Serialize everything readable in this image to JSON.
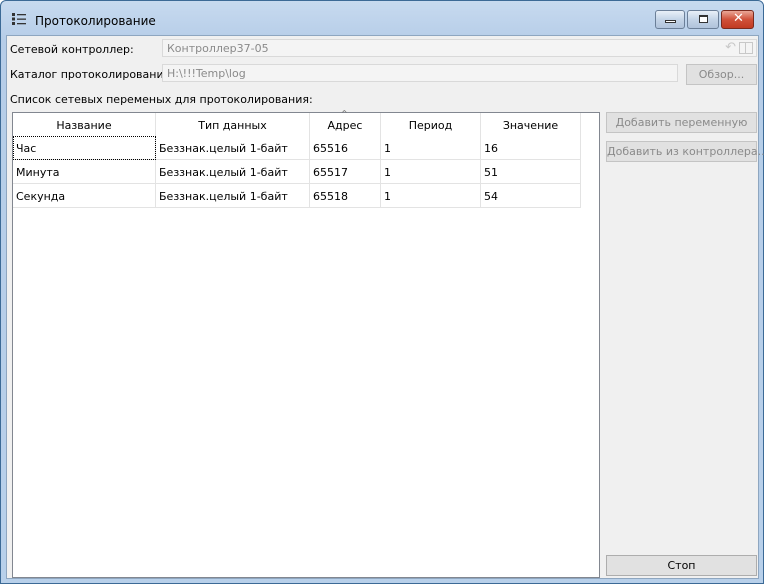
{
  "window": {
    "title": "Протоколирование",
    "icon": "list-icon"
  },
  "form": {
    "controller_label": "Сетевой  контроллер:",
    "controller_value": "Контроллер37-05",
    "catalog_label": "Каталог протоколирования:",
    "catalog_value": "H:\\!!!Temp\\log",
    "browse_button": "Обзор...",
    "list_label": "Список сетевых переменых для протоколирования:"
  },
  "table": {
    "columns": [
      "Название",
      "Тип данных",
      "Адрес",
      "Период",
      "Значение"
    ],
    "sorted_column": "Адрес",
    "rows": [
      [
        "Час",
        "Беззнак.целый 1-байт",
        "65516",
        "1",
        "16"
      ],
      [
        "Минута",
        "Беззнак.целый 1-байт",
        "65517",
        "1",
        "51"
      ],
      [
        "Секунда",
        "Беззнак.целый 1-байт",
        "65518",
        "1",
        "54"
      ]
    ]
  },
  "buttons": {
    "add_variable": "Добавить переменную",
    "add_from_controller": "Добавить из контроллера...",
    "stop": "Стоп"
  }
}
